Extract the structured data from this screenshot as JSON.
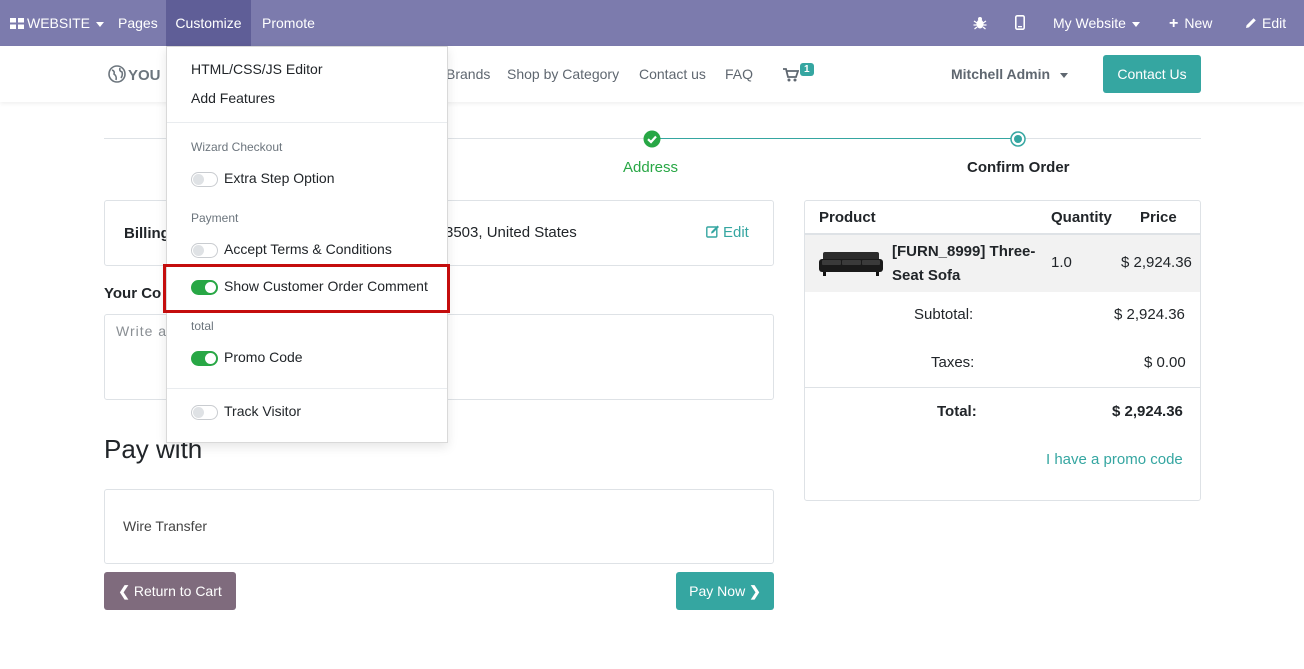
{
  "topbar": {
    "website_label": "WEBSITE",
    "pages": "Pages",
    "customize": "Customize",
    "promote": "Promote",
    "my_website": "My Website",
    "new": "New",
    "edit": "Edit"
  },
  "header": {
    "logo_text": "YOU",
    "nav": [
      "Brands",
      "Shop by Category",
      "Contact us",
      "FAQ"
    ],
    "cart_count": "1",
    "user": "Mitchell Admin",
    "contact_button": "Contact Us"
  },
  "progress": {
    "steps": [
      "Address",
      "Confirm Order"
    ]
  },
  "billing": {
    "label": "Billing",
    "address_fragment": "3503, United States",
    "edit": "Edit"
  },
  "comment": {
    "label": "Your Co",
    "placeholder": "Write a"
  },
  "payment": {
    "heading": "Pay with",
    "method": "Wire Transfer",
    "return_button": "Return to Cart",
    "pay_button": "Pay Now"
  },
  "summary": {
    "headers": [
      "Product",
      "Quantity",
      "Price"
    ],
    "item": {
      "name_line1": "[FURN_8999] Three-",
      "name_line2": "Seat Sofa",
      "quantity": "1.0",
      "price": "$ 2,924.36"
    },
    "subtotal_label": "Subtotal:",
    "subtotal": "$ 2,924.36",
    "taxes_label": "Taxes:",
    "taxes": "$ 0.00",
    "total_label": "Total:",
    "total": "$ 2,924.36",
    "promo_link": "I have a promo code"
  },
  "dropdown": {
    "editor": "HTML/CSS/JS Editor",
    "add_features": "Add Features",
    "section_wizard": "Wizard Checkout",
    "extra_step": "Extra Step Option",
    "section_payment": "Payment",
    "accept_terms": "Accept Terms & Conditions",
    "show_comment": "Show Customer Order Comment",
    "section_total": "total",
    "promo_code": "Promo Code",
    "track_visitor": "Track Visitor"
  },
  "colors": {
    "topbar": "#7c7bad",
    "accent": "#35a6a1",
    "success": "#28a745",
    "return_button": "#7f6b7d",
    "highlight": "#c40d0d"
  }
}
